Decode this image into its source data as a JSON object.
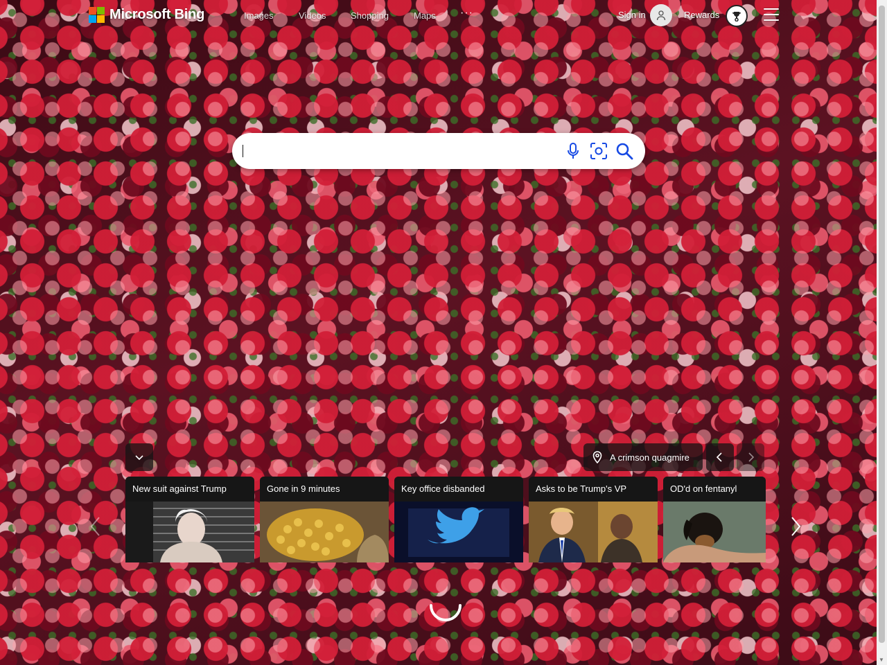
{
  "header": {
    "logo_text": "Microsoft Bing",
    "logo_colors": [
      "#f25022",
      "#7fba00",
      "#00a4ef",
      "#ffb900"
    ],
    "nav": [
      {
        "label": "Images"
      },
      {
        "label": "Videos"
      },
      {
        "label": "Shopping"
      },
      {
        "label": "Maps"
      }
    ],
    "more_label": "···",
    "signin_label": "Sign in",
    "rewards_label": "Rewards"
  },
  "search": {
    "value": "",
    "placeholder": "",
    "voice_icon": "microphone-icon",
    "visual_icon": "visual-search-icon",
    "search_icon": "search-icon",
    "accent": "#174ae4"
  },
  "image_info": {
    "location_label": "A crimson quagmire"
  },
  "news": [
    {
      "title": "New suit against Trump"
    },
    {
      "title": "Gone in 9 minutes"
    },
    {
      "title": "Key office disbanded"
    },
    {
      "title": "Asks to be Trump's VP"
    },
    {
      "title": "OD'd on fentanyl"
    }
  ]
}
